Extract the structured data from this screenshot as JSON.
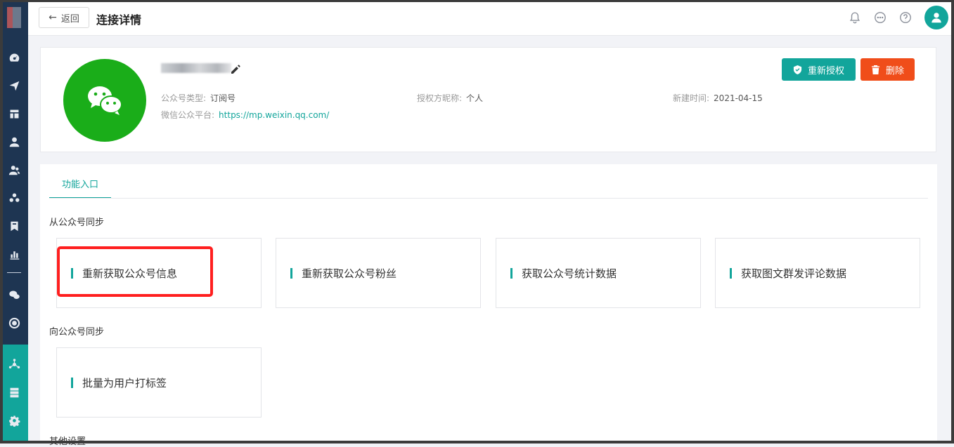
{
  "sidebar": {
    "icons": [
      "dashboard-icon",
      "send-icon",
      "layout-icon",
      "user-icon",
      "users-icon",
      "group-icon",
      "bookmark-icon",
      "bar-chart-icon",
      "wechat-icon",
      "radar-icon",
      "network-icon",
      "server-icon",
      "gear-icon"
    ]
  },
  "topbar": {
    "back_label": "返回",
    "title": "连接详情",
    "icons": [
      "bell-icon",
      "chat-icon",
      "help-icon",
      "avatar-icon"
    ]
  },
  "account": {
    "type_label": "公众号类型:",
    "type_value": "订阅号",
    "auth_label": "授权方昵称:",
    "auth_value": "个人",
    "created_label": "新建时间:",
    "created_value": "2021-04-15",
    "platform_label": "微信公众平台:",
    "platform_url": "https://mp.weixin.qq.com/",
    "reauth_label": "重新授权",
    "delete_label": "删除"
  },
  "tabs": [
    {
      "label": "功能入口",
      "active": true
    }
  ],
  "sections": [
    {
      "title": "从公众号同步",
      "cards": [
        "重新获取公众号信息",
        "重新获取公众号粉丝",
        "获取公众号统计数据",
        "获取图文群发评论数据"
      ]
    },
    {
      "title": "向公众号同步",
      "cards": [
        "批量为用户打标签"
      ]
    },
    {
      "title": "其他设置",
      "cards": []
    }
  ],
  "colors": {
    "accent": "#12a59b",
    "sidebar": "#1e3552",
    "danger": "#f04d1a",
    "wechat": "#1aad19",
    "highlight": "#ff1f1f"
  }
}
